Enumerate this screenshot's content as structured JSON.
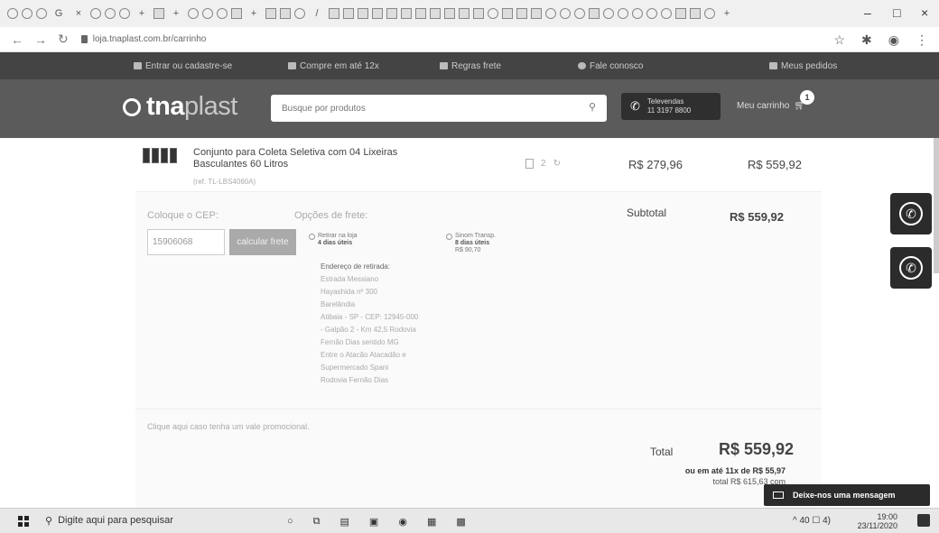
{
  "browser": {
    "url": "loja.tnaplast.com.br/carrinho",
    "new_tab": "+",
    "win_min": "–",
    "win_max": "□",
    "win_close": "×"
  },
  "topbar": {
    "login": "Entrar ou cadastre-se",
    "installments": "Compre em até 12x",
    "shipping": "Regras frete",
    "contact": "Fale conosco",
    "orders": "Meus pedidos"
  },
  "header": {
    "logo_bold": "tna",
    "logo_light": "plast",
    "search_placeholder": "Busque por produtos",
    "tele_label": "Televendas",
    "tele_number": "11 3197 8800",
    "cart_label": "Meu carrinho",
    "cart_count": "1"
  },
  "item": {
    "name": "Conjunto para Coleta Seletiva com 04 Lixeiras Basculantes 60 Litros",
    "ref": "(ref. TL-LBS4060A)",
    "qty": "2",
    "unit_price": "R$ 279,96",
    "total_price": "R$ 559,92"
  },
  "shipping": {
    "cep_label": "Coloque o CEP:",
    "cep_value": "15906068",
    "calc_button": "calcular frete",
    "options_label": "Opções de frete:",
    "opt1_name": "Retirar na loja",
    "opt1_days": "4 dias úteis",
    "opt2_name": "Sinom Transp.",
    "opt2_days": "8 dias úteis",
    "opt2_price": "R$ 90,70",
    "pickup_title": "Endereço de retirada:",
    "pickup_lines": [
      "Estrada Messiano",
      "Hayashida nº 300",
      "Barelândia",
      "Atibaia - SP - CEP: 12945-000",
      "- Galpão 2 - Km 42,5 Rodovia",
      "Fernão Dias sentido MG",
      "Entre o Atacão Atacadão e",
      "Supermercado Spani",
      "Rodovia Fernão Dias"
    ],
    "subtotal_label": "Subtotal",
    "subtotal_value": "R$ 559,92"
  },
  "summary": {
    "voucher_text": "Clique aqui caso tenha um vale promocional.",
    "total_label": "Total",
    "total_value": "R$ 559,92",
    "installments_text": "ou em até 11x de R$ 55,97",
    "total_label2": "total R$ 615,63 com"
  },
  "chat": {
    "label": "Deixe-nos uma mensagem"
  },
  "taskbar": {
    "search": "Digite aqui para pesquisar",
    "time": "19:00",
    "date": "23/11/2020",
    "tray": "^ 40 ☐ 4)"
  }
}
